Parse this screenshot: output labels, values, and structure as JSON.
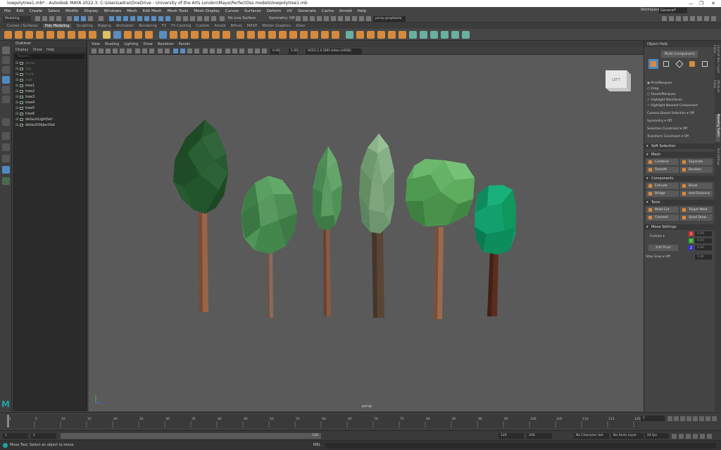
{
  "window": {
    "title": "lowpolytree1.mb* - Autodesk MAYA 2022.3: C:\\Users\\adrai\\OneDrive - University of the Arts London\\Maya\\PerfectOss models\\lowpolytree1.mb",
    "min": "—",
    "max": "❐",
    "close": "✕"
  },
  "menubar": [
    "File",
    "Edit",
    "Create",
    "Select",
    "Modify",
    "Display",
    "Windows",
    "Mesh",
    "Edit Mesh",
    "Mesh Tools",
    "Mesh Display",
    "Curves",
    "Surfaces",
    "Deform",
    "UV",
    "Generate",
    "Cache",
    "Arnold",
    "Help"
  ],
  "workspace": {
    "label": "Workspace :",
    "value": "General*"
  },
  "statusline": {
    "mode": "Modeling",
    "no_live": "No Live Surface",
    "symmetry": "Symmetry: Off",
    "camera_field": "persp.graphbeta"
  },
  "shelf_tabs": [
    "Curves / Surfaces",
    "Poly Modeling",
    "Sculpting",
    "Rigging",
    "Animation",
    "Rendering",
    "FX",
    "FX Caching",
    "Custom",
    "Arnold",
    "Bifrost",
    "MASH",
    "Motion Graphics",
    "XGen"
  ],
  "shelf_active": "Poly Modeling",
  "outliner": {
    "title": "Outliner",
    "menu": [
      "Display",
      "Show",
      "Help"
    ],
    "search_placeholder": "Search...",
    "items": [
      {
        "label": "persp",
        "dim": true
      },
      {
        "label": "top",
        "dim": true
      },
      {
        "label": "front",
        "dim": true
      },
      {
        "label": "side",
        "dim": true
      },
      {
        "label": "tree1",
        "dim": false
      },
      {
        "label": "tree2",
        "dim": false
      },
      {
        "label": "tree3",
        "dim": false
      },
      {
        "label": "tree4",
        "dim": false
      },
      {
        "label": "tree5",
        "dim": false
      },
      {
        "label": "tree6",
        "dim": false
      },
      {
        "label": "defaultLightSet",
        "dim": false
      },
      {
        "label": "defaultObjectSet",
        "dim": false
      }
    ]
  },
  "viewport": {
    "menu": [
      "View",
      "Shading",
      "Lighting",
      "Show",
      "Renderer",
      "Panels"
    ],
    "exposure": "0.00",
    "gamma": "1.00",
    "colorspace": "ACES 1.0 SDR-video (sRGB)",
    "viewcube": "LEFT",
    "camera_label": "persp"
  },
  "modeling_toolkit": {
    "menu": [
      "Object",
      "Help"
    ],
    "multi_component": "Multi-Component",
    "options": [
      {
        "label": "Pick/Marquee",
        "type": "radio"
      },
      {
        "label": "Drag",
        "type": "radio"
      },
      {
        "label": "Tweak/Marquee",
        "type": "radio"
      },
      {
        "label": "Highlight Backfaces",
        "type": "check"
      },
      {
        "label": "Highlight Nearest Component",
        "type": "check"
      }
    ],
    "camera_based": "Camera Based Selection",
    "camera_based_val": "Off",
    "symmetry": "Symmetry",
    "symmetry_val": "Off",
    "sel_constraint": "Selection Constraint",
    "sel_constraint_val": "Off",
    "transform_constraint": "Transform Constraint",
    "transform_constraint_val": "Off",
    "soft_selection": "Soft Selection",
    "mesh": "Mesh",
    "mesh_buttons": [
      "Combine",
      "Separate",
      "Smooth",
      "Boolean"
    ],
    "components": "Components",
    "component_buttons": [
      "Extrude",
      "Bevel",
      "Bridge",
      "Add Divisions"
    ],
    "tools": "Tools",
    "tool_buttons": [
      "Multi-Cut",
      "Target Weld",
      "Connect",
      "Quad Draw"
    ],
    "move_settings": "Move Settings",
    "custom": "Custom",
    "edit_pivot": "Edit Pivot",
    "step_snap": "Step Snap",
    "step_snap_val": "Off",
    "step_val": "1.00",
    "xyz": [
      "X",
      "Y",
      "Z"
    ],
    "xyz_vals": [
      "0.00",
      "0.00",
      "0.00"
    ],
    "side_tabs": [
      "Channel Box / Layer Editor",
      "Attribute Editor",
      "Modeling Toolkit",
      "Tool Settings"
    ]
  },
  "timeline": {
    "ticks": [
      "1",
      "5",
      "10",
      "15",
      "20",
      "25",
      "30",
      "35",
      "40",
      "45",
      "50",
      "55",
      "60",
      "65",
      "70",
      "75",
      "80",
      "85",
      "90",
      "95",
      "100",
      "105",
      "110",
      "115",
      "120"
    ],
    "current_frame": "1"
  },
  "range": {
    "start": "1",
    "start2": "1",
    "marker": "120",
    "end1": "120",
    "end2": "200",
    "character_set": "No Character Set",
    "anim_layer": "No Anim Layer",
    "fps": "24 fps"
  },
  "help": {
    "mel": "MEL",
    "message": "Move Tool: Select an object to move."
  },
  "colors": {
    "accent": "#d88a3c",
    "viewport_bg": "#5a5a5a"
  }
}
